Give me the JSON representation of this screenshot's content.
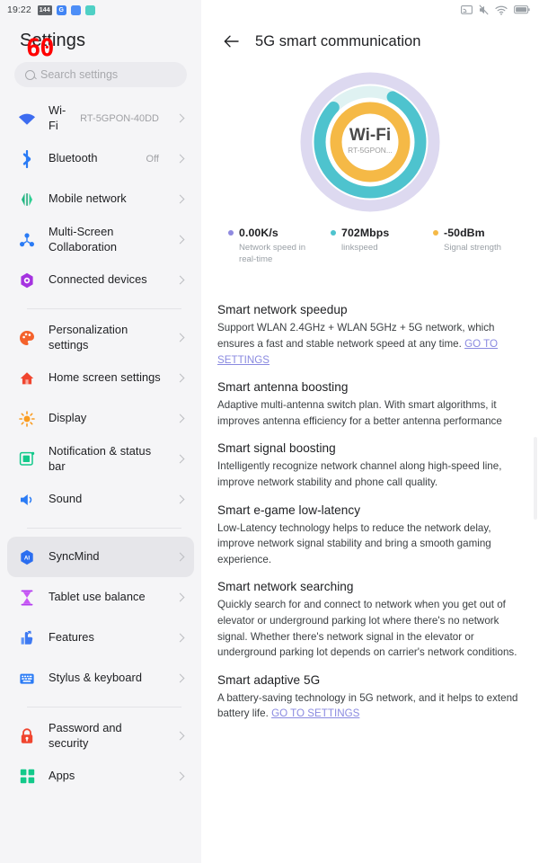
{
  "statusbar": {
    "clock": "19:22",
    "left_icons": [
      "app-badge-icon",
      "google-icon",
      "app-blue-icon",
      "app-teal-icon"
    ],
    "right_icons": [
      "cast-screen-icon",
      "mute-icon",
      "wifi-icon",
      "battery-icon"
    ]
  },
  "overlay": {
    "marker": "60"
  },
  "sidebar": {
    "title": "Settings",
    "search": {
      "placeholder": "Search settings"
    },
    "items": [
      {
        "icon": "wifi-icon",
        "label": "Wi-Fi",
        "value": "RT-5GPON-40DD",
        "active": false
      },
      {
        "icon": "bluetooth-icon",
        "label": "Bluetooth",
        "value": "Off",
        "active": false
      },
      {
        "icon": "mobile-network-icon",
        "label": "Mobile network",
        "value": "",
        "active": false
      },
      {
        "icon": "multi-screen-icon",
        "label": "Multi-Screen Collaboration",
        "value": "",
        "active": false
      },
      {
        "icon": "connected-devices-icon",
        "label": "Connected devices",
        "value": "",
        "active": false
      },
      {
        "divider": true
      },
      {
        "icon": "personalization-icon",
        "label": "Personalization settings",
        "value": "",
        "active": false
      },
      {
        "icon": "home-screen-icon",
        "label": "Home screen settings",
        "value": "",
        "active": false
      },
      {
        "icon": "display-icon",
        "label": "Display",
        "value": "",
        "active": false
      },
      {
        "icon": "notification-bar-icon",
        "label": "Notification & status bar",
        "value": "",
        "active": false
      },
      {
        "icon": "sound-icon",
        "label": "Sound",
        "value": "",
        "active": false
      },
      {
        "divider": true
      },
      {
        "icon": "syncmind-icon",
        "label": "SyncMind",
        "value": "",
        "active": true
      },
      {
        "icon": "tablet-balance-icon",
        "label": "Tablet use balance",
        "value": "",
        "active": false
      },
      {
        "icon": "features-icon",
        "label": "Features",
        "value": "",
        "active": false
      },
      {
        "icon": "stylus-keyboard-icon",
        "label": "Stylus & keyboard",
        "value": "",
        "active": false
      },
      {
        "divider": true
      },
      {
        "icon": "password-security-icon",
        "label": "Password and security",
        "value": "",
        "active": false
      },
      {
        "icon": "apps-icon",
        "label": "Apps",
        "value": "",
        "active": false
      }
    ]
  },
  "main": {
    "back_label": "back-arrow",
    "title": "5G smart communication",
    "ring": {
      "center_label": "Wi-Fi",
      "center_sub": "RT-5GPON...",
      "outer_color": "#ddd9f0",
      "track_color": "#dff2f2",
      "arc_color": "#4ec3ce",
      "inner_color": "#f5b946"
    },
    "stats": [
      {
        "dot": "#8f8ae0",
        "value": "0.00K/s",
        "desc": "Network speed in real-time"
      },
      {
        "dot": "#4ec3ce",
        "value": "702Mbps",
        "desc": "linkspeed"
      },
      {
        "dot": "#f5b946",
        "value": "-50dBm",
        "desc": "Signal strength"
      }
    ],
    "sections": [
      {
        "title": "Smart network speedup",
        "body": "Support WLAN 2.4GHz + WLAN 5GHz + 5G network, which ensures a fast and stable network speed at any time. ",
        "link": "GO TO SETTINGS",
        "body_after": ""
      },
      {
        "title": "Smart antenna boosting",
        "body": "Adaptive multi-antenna switch plan. With smart algorithms, it improves antenna efficiency for a better antenna performance",
        "link": "",
        "body_after": ""
      },
      {
        "title": "Smart signal boosting",
        "body": "Intelligently recognize network channel along high-speed line, improve network stability and phone call quality.",
        "link": "",
        "body_after": ""
      },
      {
        "title": "Smart e-game low-latency",
        "body": "Low-Latency technology helps to reduce the network delay, improve network signal stability and bring a smooth gaming experience.",
        "link": "",
        "body_after": ""
      },
      {
        "title": "Smart network searching",
        "body": "Quickly search for and connect to network when you get out of elevator or underground parking lot where there's no network signal. Whether there's network signal in the elevator or underground parking lot depends on carrier's network conditions.",
        "link": "",
        "body_after": ""
      },
      {
        "title": "Smart adaptive 5G",
        "body": "A battery-saving technology in 5G network, and it helps to extend battery life. ",
        "link": "GO TO SETTINGS",
        "body_after": ""
      }
    ]
  }
}
